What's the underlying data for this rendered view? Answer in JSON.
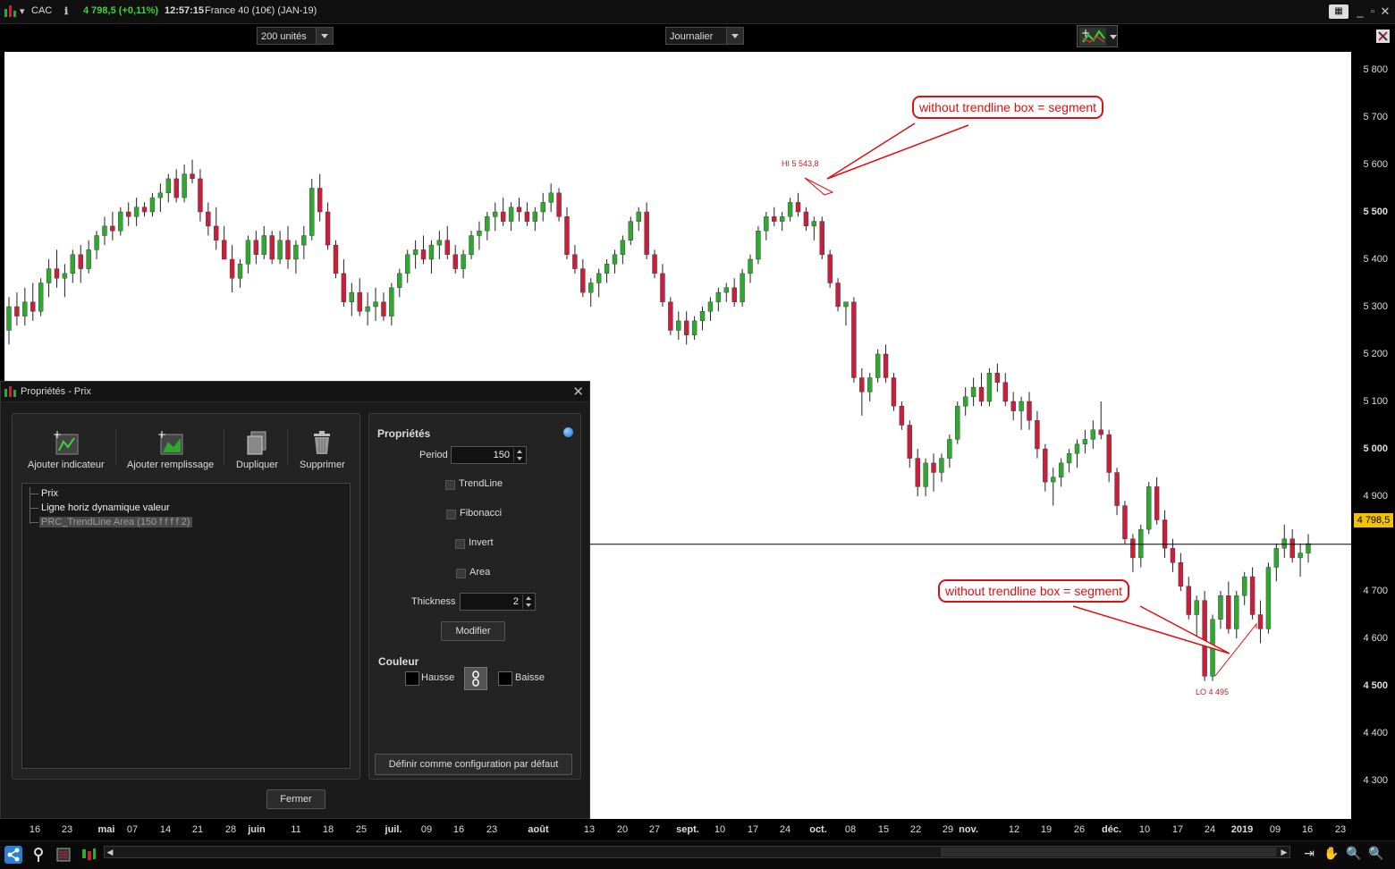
{
  "titlebar": {
    "symbol": "CAC",
    "info_icon": "info-icon",
    "price": "4 798,5 (+0,11%)",
    "time": "12:57:15",
    "instrument": "France 40 (10€) (JAN-19)",
    "price_color": "#3dd23d"
  },
  "toolbar": {
    "units_select": "200 unités",
    "period_select": "Journalier"
  },
  "chart": {
    "last_price": "4 798,5",
    "y_labels": [
      "5 800",
      "5 700",
      "5 600",
      "5 500",
      "5 400",
      "5 300",
      "5 200",
      "5 100",
      "5 000",
      "4 900",
      "4 700",
      "4 600",
      "4 500",
      "4 400",
      "4 300"
    ],
    "x_labels": [
      "16",
      "23",
      "mai",
      "07",
      "14",
      "21",
      "28",
      "juin",
      "11",
      "18",
      "25",
      "juil.",
      "09",
      "16",
      "23",
      "août",
      "13",
      "20",
      "27",
      "sept.",
      "10",
      "17",
      "24",
      "oct.",
      "08",
      "15",
      "22",
      "29",
      "nov.",
      "12",
      "19",
      "26",
      "déc.",
      "10",
      "17",
      "24",
      "2019",
      "09",
      "16",
      "23"
    ],
    "annotation_top": "without trendline box = segment",
    "annotation_bottom": "without trendline box = segment",
    "hi_label": "HI 5 543,8",
    "lo_label": "LO 4 495",
    "up_color": "#2fa82f",
    "down_color": "#c8203c",
    "annotation_color": "#e01010",
    "price_tag_color": "#f2c200"
  },
  "chart_data": {
    "type": "candlestick",
    "title": "CAC",
    "ylim": [
      4250,
      5850
    ],
    "candles": [
      [
        5250,
        5320,
        5220,
        5300
      ],
      [
        5300,
        5330,
        5260,
        5280
      ],
      [
        5280,
        5340,
        5260,
        5310
      ],
      [
        5310,
        5350,
        5270,
        5290
      ],
      [
        5290,
        5360,
        5280,
        5350
      ],
      [
        5350,
        5400,
        5320,
        5380
      ],
      [
        5380,
        5420,
        5340,
        5360
      ],
      [
        5360,
        5390,
        5320,
        5370
      ],
      [
        5370,
        5420,
        5350,
        5410
      ],
      [
        5410,
        5430,
        5350,
        5380
      ],
      [
        5380,
        5440,
        5370,
        5420
      ],
      [
        5420,
        5460,
        5400,
        5450
      ],
      [
        5450,
        5490,
        5430,
        5470
      ],
      [
        5470,
        5500,
        5440,
        5460
      ],
      [
        5460,
        5510,
        5450,
        5500
      ],
      [
        5500,
        5520,
        5470,
        5490
      ],
      [
        5490,
        5530,
        5470,
        5510
      ],
      [
        5510,
        5520,
        5490,
        5500
      ],
      [
        5500,
        5540,
        5490,
        5530
      ],
      [
        5530,
        5560,
        5500,
        5540
      ],
      [
        5540,
        5580,
        5520,
        5570
      ],
      [
        5570,
        5590,
        5520,
        5530
      ],
      [
        5530,
        5600,
        5520,
        5580
      ],
      [
        5580,
        5610,
        5560,
        5570
      ],
      [
        5570,
        5590,
        5480,
        5500
      ],
      [
        5500,
        5520,
        5450,
        5470
      ],
      [
        5470,
        5510,
        5420,
        5440
      ],
      [
        5440,
        5470,
        5400,
        5400
      ],
      [
        5400,
        5430,
        5330,
        5360
      ],
      [
        5360,
        5400,
        5340,
        5390
      ],
      [
        5390,
        5450,
        5370,
        5440
      ],
      [
        5440,
        5460,
        5390,
        5410
      ],
      [
        5410,
        5470,
        5400,
        5450
      ],
      [
        5450,
        5460,
        5390,
        5400
      ],
      [
        5400,
        5460,
        5390,
        5440
      ],
      [
        5440,
        5470,
        5380,
        5400
      ],
      [
        5400,
        5440,
        5370,
        5430
      ],
      [
        5430,
        5470,
        5400,
        5450
      ],
      [
        5450,
        5570,
        5440,
        5550
      ],
      [
        5550,
        5580,
        5480,
        5500
      ],
      [
        5500,
        5520,
        5420,
        5430
      ],
      [
        5430,
        5440,
        5360,
        5370
      ],
      [
        5370,
        5400,
        5300,
        5310
      ],
      [
        5310,
        5350,
        5280,
        5330
      ],
      [
        5330,
        5360,
        5280,
        5290
      ],
      [
        5290,
        5330,
        5260,
        5300
      ],
      [
        5300,
        5340,
        5270,
        5310
      ],
      [
        5310,
        5330,
        5270,
        5280
      ],
      [
        5280,
        5350,
        5260,
        5340
      ],
      [
        5340,
        5380,
        5320,
        5370
      ],
      [
        5370,
        5420,
        5350,
        5410
      ],
      [
        5410,
        5440,
        5380,
        5420
      ],
      [
        5420,
        5450,
        5390,
        5400
      ],
      [
        5400,
        5440,
        5370,
        5430
      ],
      [
        5430,
        5460,
        5400,
        5440
      ],
      [
        5440,
        5470,
        5400,
        5410
      ],
      [
        5410,
        5430,
        5370,
        5380
      ],
      [
        5380,
        5420,
        5360,
        5410
      ],
      [
        5410,
        5460,
        5400,
        5450
      ],
      [
        5450,
        5480,
        5420,
        5460
      ],
      [
        5460,
        5500,
        5440,
        5490
      ],
      [
        5490,
        5520,
        5460,
        5500
      ],
      [
        5500,
        5530,
        5470,
        5480
      ],
      [
        5480,
        5520,
        5460,
        5510
      ],
      [
        5510,
        5530,
        5480,
        5500
      ],
      [
        5500,
        5520,
        5470,
        5480
      ],
      [
        5480,
        5510,
        5460,
        5500
      ],
      [
        5500,
        5540,
        5480,
        5520
      ],
      [
        5520,
        5560,
        5500,
        5540
      ],
      [
        5540,
        5550,
        5480,
        5490
      ],
      [
        5490,
        5510,
        5400,
        5410
      ],
      [
        5410,
        5430,
        5370,
        5380
      ],
      [
        5380,
        5400,
        5320,
        5330
      ],
      [
        5330,
        5360,
        5300,
        5350
      ],
      [
        5350,
        5380,
        5320,
        5370
      ],
      [
        5370,
        5400,
        5350,
        5390
      ],
      [
        5390,
        5420,
        5370,
        5410
      ],
      [
        5410,
        5450,
        5390,
        5440
      ],
      [
        5440,
        5490,
        5430,
        5480
      ],
      [
        5480,
        5510,
        5460,
        5500
      ],
      [
        5500,
        5520,
        5400,
        5410
      ],
      [
        5410,
        5420,
        5360,
        5370
      ],
      [
        5370,
        5390,
        5300,
        5310
      ],
      [
        5310,
        5320,
        5240,
        5250
      ],
      [
        5250,
        5290,
        5230,
        5270
      ],
      [
        5270,
        5290,
        5220,
        5240
      ],
      [
        5240,
        5280,
        5230,
        5270
      ],
      [
        5270,
        5300,
        5250,
        5290
      ],
      [
        5290,
        5320,
        5270,
        5310
      ],
      [
        5310,
        5340,
        5290,
        5330
      ],
      [
        5330,
        5350,
        5310,
        5340
      ],
      [
        5340,
        5360,
        5300,
        5310
      ],
      [
        5310,
        5380,
        5300,
        5370
      ],
      [
        5370,
        5410,
        5350,
        5400
      ],
      [
        5400,
        5470,
        5390,
        5460
      ],
      [
        5460,
        5500,
        5440,
        5490
      ],
      [
        5490,
        5510,
        5470,
        5480
      ],
      [
        5480,
        5500,
        5460,
        5490
      ],
      [
        5490,
        5530,
        5480,
        5520
      ],
      [
        5520,
        5540,
        5490,
        5500
      ],
      [
        5500,
        5510,
        5460,
        5470
      ],
      [
        5470,
        5490,
        5440,
        5480
      ],
      [
        5480,
        5490,
        5400,
        5410
      ],
      [
        5410,
        5420,
        5340,
        5350
      ],
      [
        5350,
        5360,
        5290,
        5300
      ],
      [
        5300,
        5310,
        5260,
        5310
      ],
      [
        5310,
        5320,
        5140,
        5150
      ],
      [
        5150,
        5170,
        5070,
        5120
      ],
      [
        5120,
        5160,
        5100,
        5150
      ],
      [
        5150,
        5210,
        5140,
        5200
      ],
      [
        5200,
        5220,
        5140,
        5150
      ],
      [
        5150,
        5160,
        5080,
        5090
      ],
      [
        5090,
        5100,
        5040,
        5050
      ],
      [
        5050,
        5060,
        4960,
        4980
      ],
      [
        4980,
        5000,
        4900,
        4920
      ],
      [
        4920,
        4980,
        4900,
        4970
      ],
      [
        4970,
        4990,
        4910,
        4950
      ],
      [
        4950,
        4990,
        4930,
        4980
      ],
      [
        4980,
        5030,
        4960,
        5020
      ],
      [
        5020,
        5100,
        5010,
        5090
      ],
      [
        5090,
        5130,
        5070,
        5110
      ],
      [
        5110,
        5150,
        5090,
        5130
      ],
      [
        5130,
        5160,
        5090,
        5100
      ],
      [
        5100,
        5170,
        5090,
        5160
      ],
      [
        5160,
        5180,
        5120,
        5140
      ],
      [
        5140,
        5160,
        5090,
        5100
      ],
      [
        5100,
        5120,
        5060,
        5080
      ],
      [
        5080,
        5110,
        5040,
        5100
      ],
      [
        5100,
        5120,
        5040,
        5060
      ],
      [
        5060,
        5080,
        4980,
        5000
      ],
      [
        5000,
        5010,
        4910,
        4930
      ],
      [
        4930,
        4960,
        4880,
        4940
      ],
      [
        4940,
        4980,
        4920,
        4970
      ],
      [
        4970,
        5000,
        4950,
        4990
      ],
      [
        4990,
        5020,
        4960,
        5010
      ],
      [
        5010,
        5040,
        4990,
        5020
      ],
      [
        5020,
        5060,
        5000,
        5040
      ],
      [
        5040,
        5100,
        5020,
        5030
      ],
      [
        5030,
        5040,
        4930,
        4950
      ],
      [
        4950,
        4960,
        4860,
        4880
      ],
      [
        4880,
        4890,
        4800,
        4810
      ],
      [
        4810,
        4820,
        4740,
        4770
      ],
      [
        4770,
        4840,
        4750,
        4830
      ],
      [
        4830,
        4930,
        4820,
        4920
      ],
      [
        4920,
        4940,
        4840,
        4850
      ],
      [
        4850,
        4870,
        4770,
        4790
      ],
      [
        4790,
        4810,
        4740,
        4760
      ],
      [
        4760,
        4780,
        4700,
        4710
      ],
      [
        4710,
        4730,
        4640,
        4650
      ],
      [
        4650,
        4690,
        4600,
        4680
      ],
      [
        4680,
        4700,
        4510,
        4520
      ],
      [
        4520,
        4650,
        4510,
        4640
      ],
      [
        4640,
        4700,
        4620,
        4690
      ],
      [
        4690,
        4720,
        4610,
        4620
      ],
      [
        4620,
        4700,
        4600,
        4690
      ],
      [
        4690,
        4740,
        4670,
        4730
      ],
      [
        4730,
        4750,
        4640,
        4650
      ],
      [
        4650,
        4680,
        4590,
        4620
      ],
      [
        4620,
        4760,
        4610,
        4750
      ],
      [
        4750,
        4800,
        4720,
        4790
      ],
      [
        4790,
        4840,
        4770,
        4810
      ],
      [
        4810,
        4830,
        4760,
        4770
      ],
      [
        4770,
        4800,
        4730,
        4780
      ],
      [
        4780,
        4820,
        4760,
        4800
      ]
    ]
  },
  "dialog": {
    "title": "Propriétés - Prix",
    "tools": {
      "add_indicator": "Ajouter indicateur",
      "add_fill": "Ajouter remplissage",
      "duplicate": "Dupliquer",
      "delete": "Supprimer"
    },
    "tree": [
      "Prix",
      "Ligne horiz dynamique valeur",
      "PRC_TrendLine Area (150 f f f f 2)"
    ],
    "properties_title": "Propriétés",
    "period_label": "Period",
    "period_value": "150",
    "trendline_label": "TrendLine",
    "fibonacci_label": "Fibonacci",
    "invert_label": "Invert",
    "area_label": "Area",
    "thickness_label": "Thickness",
    "thickness_value": "2",
    "modify_button": "Modifier",
    "color_title": "Couleur",
    "hausse_label": "Hausse",
    "baisse_label": "Baisse",
    "default_button": "Définir comme configuration par défaut",
    "close_button": "Fermer"
  }
}
